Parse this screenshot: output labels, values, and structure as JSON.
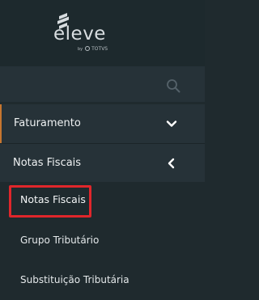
{
  "brand": {
    "name": "eleve",
    "sub_prefix": "by",
    "sub_brand": "TOTVS"
  },
  "search": {
    "icon": "search-icon"
  },
  "menu": {
    "items": [
      {
        "label": "Faturamento",
        "icon": "chevron-down-icon",
        "active": true
      },
      {
        "label": "Notas Fiscais",
        "icon": "chevron-left-icon",
        "expanded": true
      }
    ],
    "submenu": [
      {
        "label": "Notas Fiscais",
        "highlighted": true
      },
      {
        "label": "Grupo Tributário"
      },
      {
        "label": "Substituição Tributária"
      }
    ]
  },
  "colors": {
    "background": "#1f2a2e",
    "row": "#263238",
    "accent": "#c6762f",
    "highlight": "#e0262b",
    "text": "#eef1f2"
  }
}
